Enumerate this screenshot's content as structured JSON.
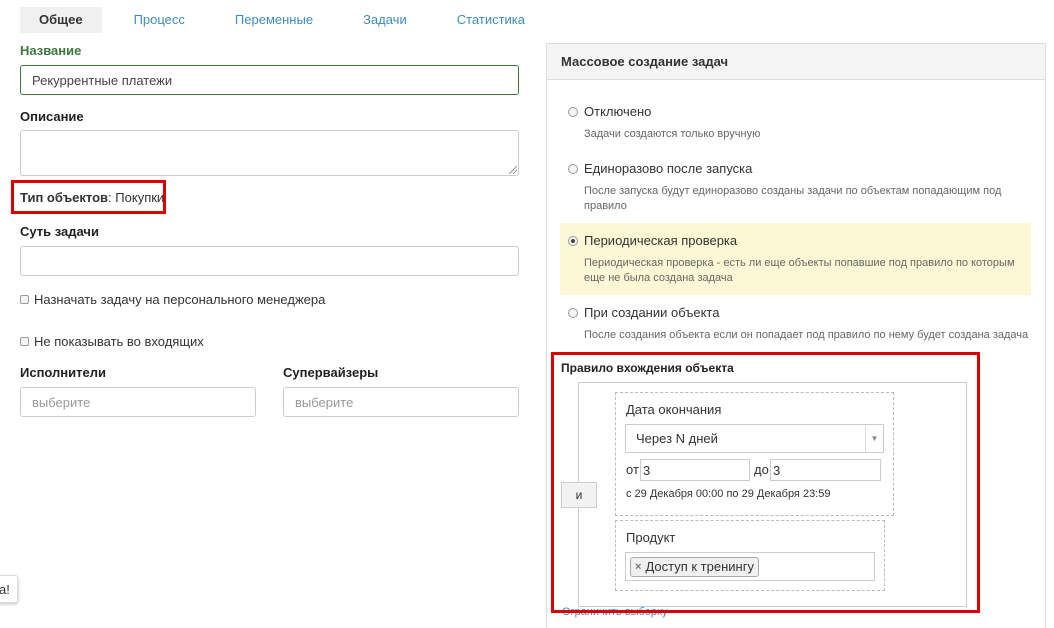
{
  "tabs": [
    "Общее",
    "Процесс",
    "Переменные",
    "Задачи",
    "Статистика"
  ],
  "form": {
    "name_label": "Название",
    "name_value": "Рекуррентные платежи",
    "description_label": "Описание",
    "object_type_label": "Тип объектов",
    "object_type_sep": ":",
    "object_type_value": "Покупки",
    "task_essence_label": "Суть задачи",
    "assign_manager_label": "Назначать задачу на персонального менеджера",
    "hide_inbox_label": "Не показывать во входящих",
    "executors_label": "Исполнители",
    "executors_placeholder": "выберите",
    "supervisors_label": "Супервайзеры",
    "supervisors_placeholder": "выберите"
  },
  "mass_creation": {
    "title": "Массовое создание задач",
    "options": [
      {
        "label": "Отключено",
        "desc": "Задачи создаются только вручную",
        "selected": false
      },
      {
        "label": "Единоразово после запуска",
        "desc": "После запуска будут единоразово созданы задачи по объектам попадающим под правило",
        "selected": false
      },
      {
        "label": "Периодическая проверка",
        "desc": "Периодическая проверка - есть ли еще объекты попавшие под правило по которым еще не была создана задача",
        "selected": true
      },
      {
        "label": "При создании объекта",
        "desc": "После создания объекта если он попадает под правило по нему будет создана задача",
        "selected": false
      }
    ]
  },
  "rule": {
    "title": "Правило вхождения объекта",
    "and_button": "и",
    "date_block": {
      "title": "Дата окончания",
      "select_value": "Через N дней",
      "from_label": "от",
      "from_value": "3",
      "to_label": "до",
      "to_value": "3",
      "range_text": "с 29 Декабря 00:00 по 29 Декабря 23:59"
    },
    "product_block": {
      "title": "Продукт",
      "tag": "Доступ к тренингу",
      "tag_remove": "×"
    },
    "limit_link": "Ограничить выборку"
  },
  "edge_tip": "а!",
  "colors": {
    "accent_link": "#3c8dbc",
    "label_green": "#3c763d",
    "highlight_red": "#dd0000",
    "selected_option_bg": "#fcf8d5"
  }
}
